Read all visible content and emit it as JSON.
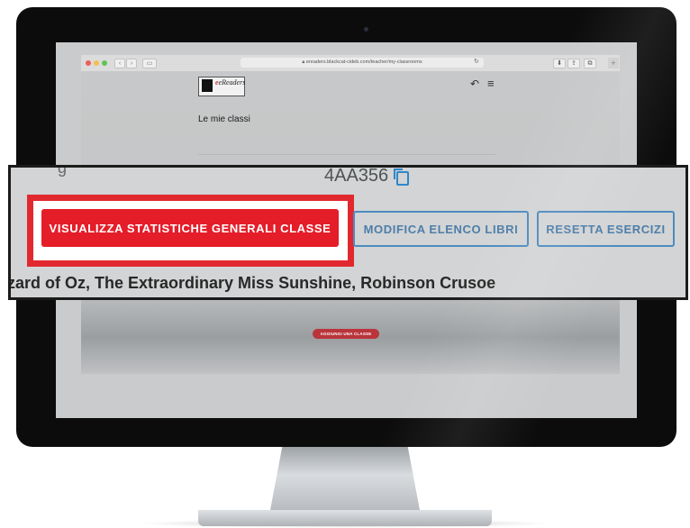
{
  "browser": {
    "url": "ereaders.blackcat-cideb.com/teacher/my-classrooms",
    "lock_icon": "lock-icon",
    "reload_icon": "reload-icon"
  },
  "site": {
    "logo_text": "eReaders",
    "back_icon": "back-arrow-icon",
    "menu_icon": "hamburger-menu-icon"
  },
  "page": {
    "title": "Le mie classi",
    "add_class_label": "AGGIUNGI UNA CLASSE"
  },
  "callout": {
    "class_code": "4AA356",
    "stats_button_label": "VISUALIZZA STATISTICHE GENERALI CLASSE",
    "edit_books_label": "MODIFICA ELENCO LIBRI",
    "reset_exercises_label": "RESETTA ESERCIZI",
    "books_list": "zard of Oz, The Extraordinary Miss Sunshine, Robinson Crusoe"
  },
  "colors": {
    "accent_red": "#e41d29",
    "outline_blue": "#4d8bc0",
    "highlight_red": "#e2282f"
  }
}
